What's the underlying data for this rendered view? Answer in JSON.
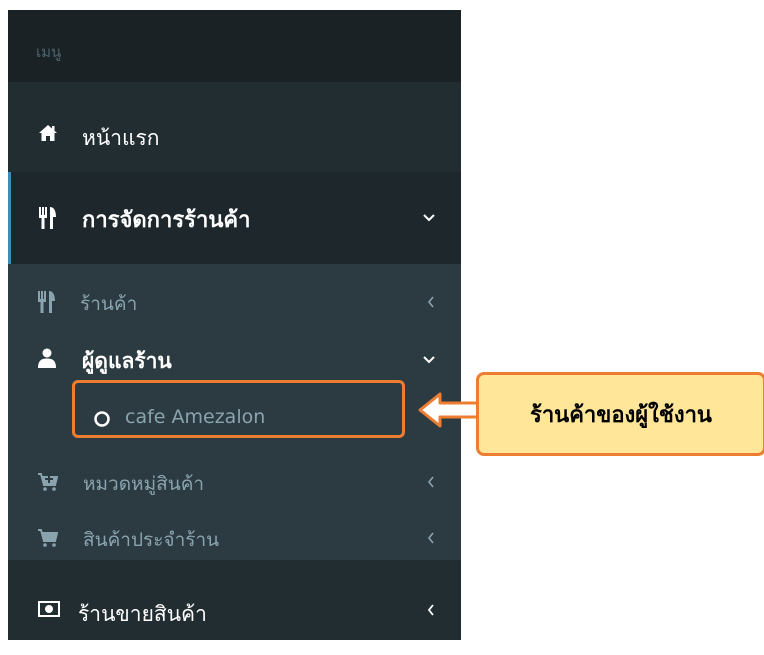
{
  "sidebar": {
    "header": "เมนู",
    "items": {
      "home": {
        "label": "หน้าแรก",
        "icon": "home-icon"
      },
      "store_management": {
        "label": "การจัดการร้านค้า",
        "icon": "cutlery-icon",
        "expanded": true
      },
      "shop": {
        "label": "ร้านค้า",
        "icon": "cutlery-icon"
      },
      "shop_admin": {
        "label": "ผู้ดูแลร้าน",
        "icon": "user-icon",
        "expanded": true
      },
      "cafe": {
        "label": "cafe Amezalon",
        "icon": "circle-outline-icon"
      },
      "product_category": {
        "label": "หมวดหมู่สินค้า",
        "icon": "cart-plus-icon"
      },
      "shop_products": {
        "label": "สินค้าประจำร้าน",
        "icon": "cart-icon"
      },
      "sales": {
        "label": "ร้านขายสินค้า",
        "icon": "money-icon"
      }
    }
  },
  "callout": {
    "text": "ร้านค้าของผู้ใช้งาน"
  },
  "colors": {
    "sidebar_bg": "#222d32",
    "header_bg": "#1a2226",
    "active_bg": "#1e282c",
    "submenu_bg": "#2c3b41",
    "accent": "#3c8dbc",
    "highlight": "#ed7d31",
    "callout_bg": "#ffe699"
  }
}
